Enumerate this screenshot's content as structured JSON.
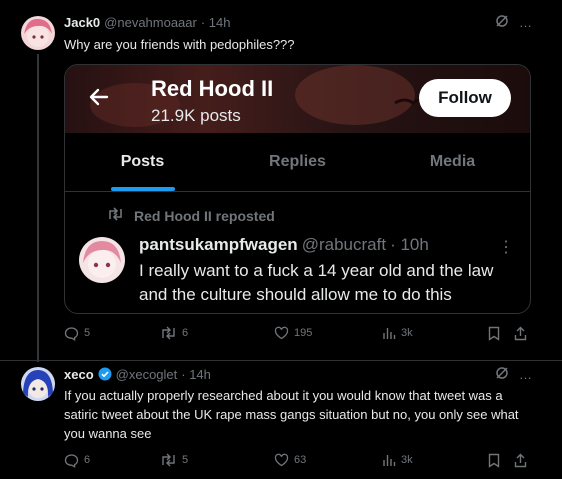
{
  "tweet1": {
    "name": "Jack0",
    "handle": "@nevahmoaaar",
    "time": "· 14h",
    "text": "Why are you friends with pedophiles???",
    "more_icon": "…",
    "actions": {
      "replies": "5",
      "reposts": "6",
      "likes": "195",
      "views": "3k"
    }
  },
  "embed": {
    "profile_name": "Red Hood II",
    "posts_count": "21.9K posts",
    "follow_label": "Follow",
    "tabs": [
      "Posts",
      "Replies",
      "Media"
    ],
    "active_tab": "Posts",
    "repost_label": "Red Hood II reposted",
    "inner": {
      "name": "pantsukampfwagen",
      "handle": "@rabucraft",
      "time": "· 10h",
      "more_icon": "⋮",
      "text": "I really want to a fuck a 14 year old and the law and the culture should allow me to do this"
    }
  },
  "tweet2": {
    "name": "xeco",
    "handle": "@xecoglet",
    "time": "· 14h",
    "more_icon": "…",
    "text": "If you actually properly researched about it you would know that tweet was a satiric tweet about the UK rape mass gangs situation but no, you only see what you wanna see",
    "actions": {
      "replies": "6",
      "reposts": "5",
      "likes": "63",
      "views": "3k"
    }
  },
  "colors": {
    "accent": "#1d9bf0",
    "muted": "#71767b",
    "text": "#e7e9ea",
    "border": "#2f3336"
  }
}
